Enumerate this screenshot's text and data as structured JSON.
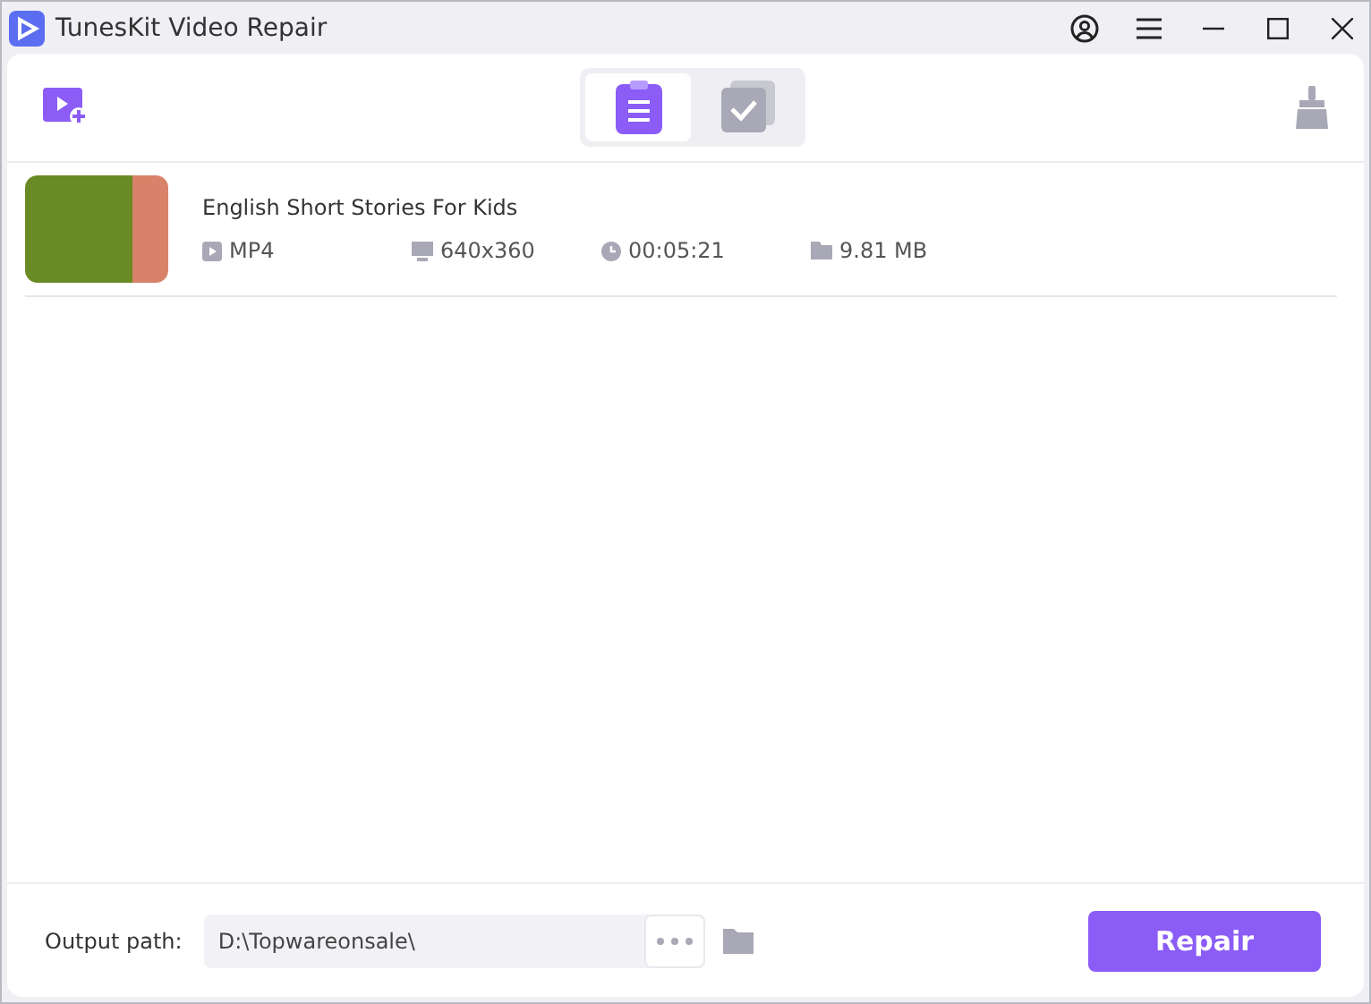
{
  "window": {
    "title": "TunesKit Video Repair"
  },
  "tabs": [
    {
      "kind": "list",
      "selected": true
    },
    {
      "kind": "done",
      "selected": false
    }
  ],
  "videos": [
    {
      "title": "English Short Stories For Kids",
      "format": "MP4",
      "resolution": "640x360",
      "duration": "00:05:21",
      "size": "9.81 MB"
    }
  ],
  "output": {
    "label": "Output path:",
    "value": "D:\\Topwareonsale\\"
  },
  "repair_button": "Repair"
}
